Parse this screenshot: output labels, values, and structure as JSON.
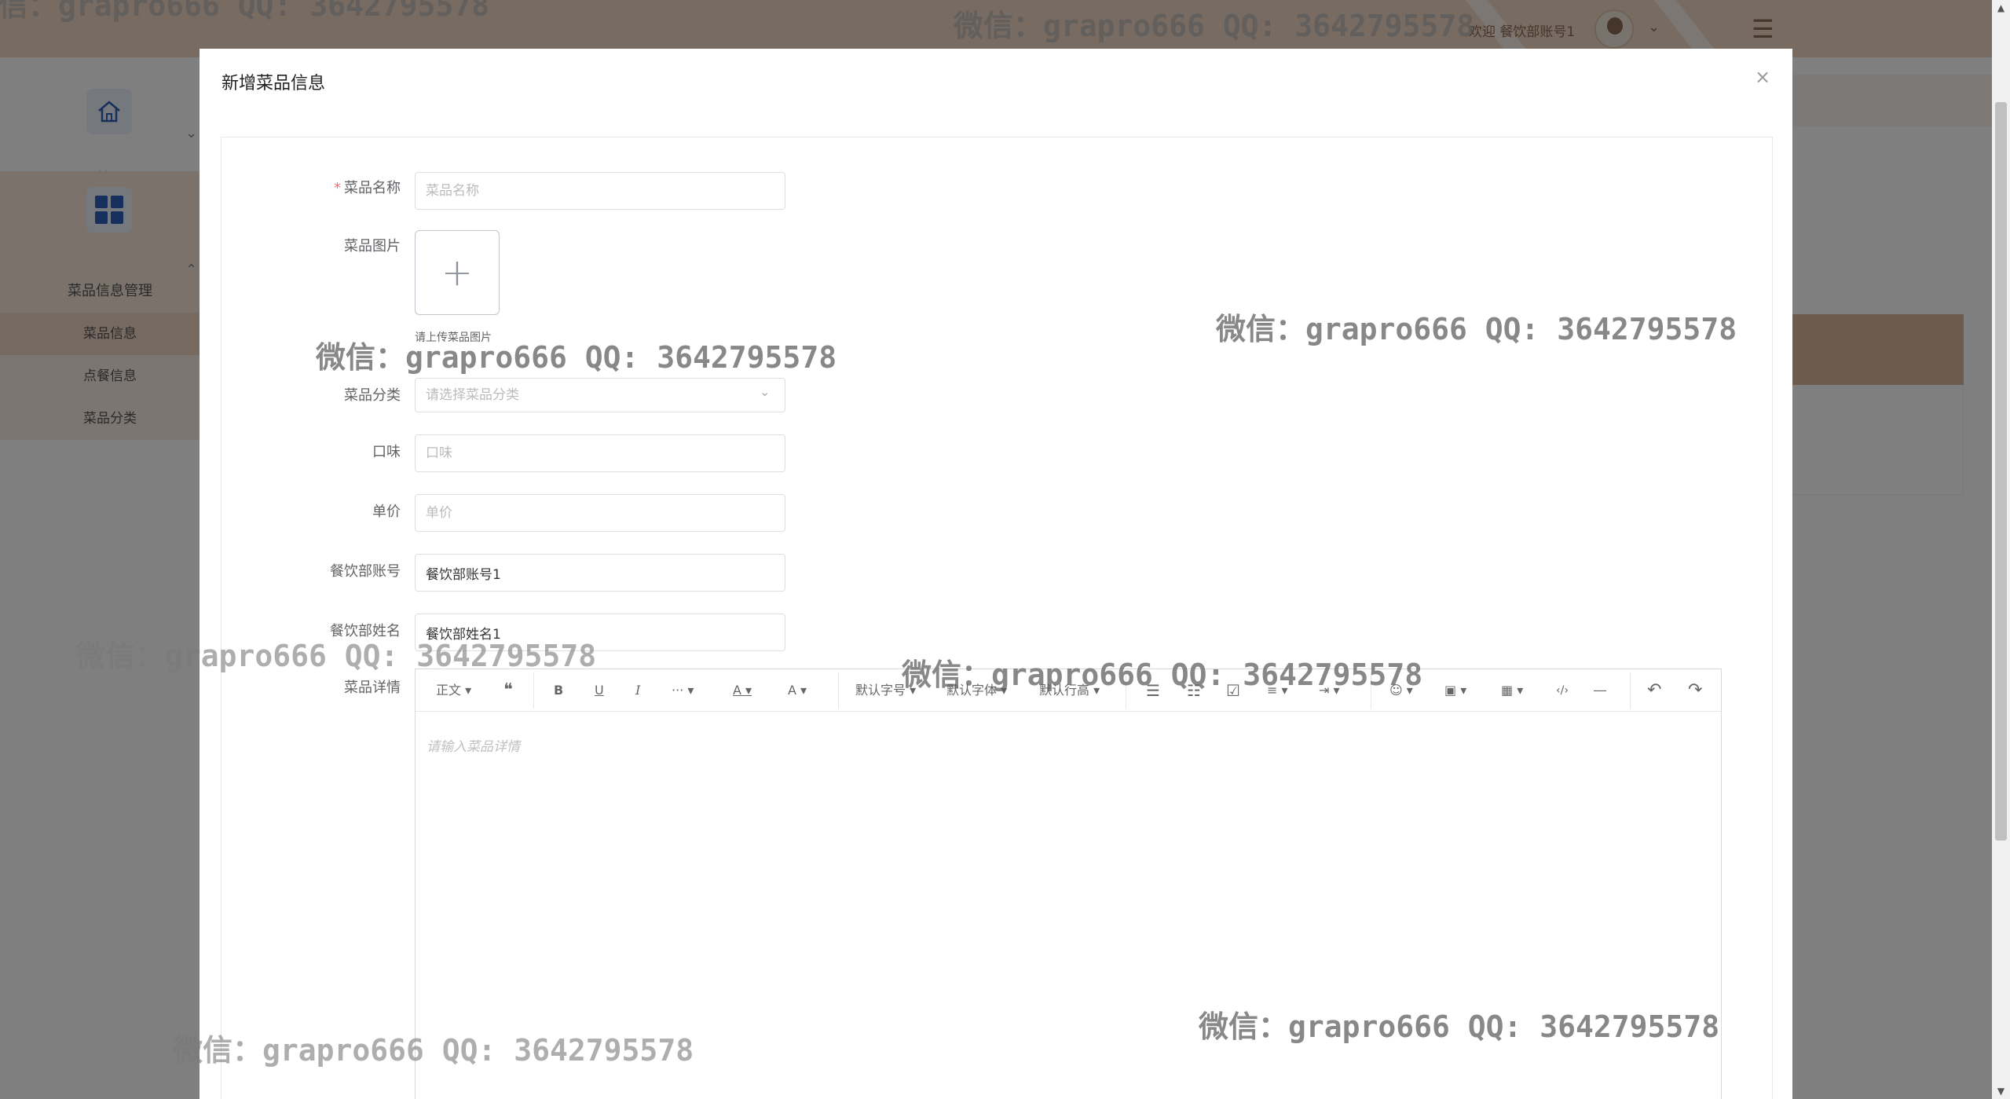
{
  "topbar": {
    "welcome": "欢迎 餐饮部账号1",
    "chevron": "⌄",
    "menu_icon": "☰"
  },
  "sidebar": {
    "home_label": "首页",
    "category_label": "菜品信息管理",
    "items": [
      {
        "label": "菜品信息"
      },
      {
        "label": "点餐信息"
      },
      {
        "label": "菜品分类"
      }
    ],
    "collapse_arrow": "⌄",
    "expand_arrow": "⌃"
  },
  "modal": {
    "title": "新增菜品信息",
    "close": "×",
    "fields": {
      "name": {
        "label": "菜品名称",
        "required_mark": "*",
        "placeholder": "菜品名称"
      },
      "image": {
        "label": "菜品图片",
        "upload_plus": "+",
        "tip": "请上传菜品图片"
      },
      "category": {
        "label": "菜品分类",
        "placeholder": "请选择菜品分类",
        "arrow": "⌄"
      },
      "taste": {
        "label": "口味",
        "placeholder": "口味"
      },
      "price": {
        "label": "单价",
        "placeholder": "单价"
      },
      "account": {
        "label": "餐饮部账号",
        "value": "餐饮部账号1"
      },
      "staff_name": {
        "label": "餐饮部姓名",
        "value": "餐饮部姓名1"
      },
      "detail": {
        "label": "菜品详情",
        "placeholder": "请输入菜品详情"
      }
    },
    "toolbar": {
      "paragraph": "正文 ▾",
      "quote": "❝",
      "bold": "B",
      "underline": "U",
      "italic": "I",
      "more": "··· ▾",
      "font_color": "A ▾",
      "bg_color": "A ▾",
      "font_size": "默认字号 ▾",
      "font_family": "默认字体 ▾",
      "line_height": "默认行高 ▾",
      "bullet_list": "☰",
      "numbered_list": "☷",
      "todo": "☑",
      "align": "≡ ▾",
      "indent": "⇥ ▾",
      "emoji": "☺ ▾",
      "image": "▣ ▾",
      "table": "▦ ▾",
      "code": "‹/›",
      "divider": "―",
      "undo": "↶",
      "redo": "↷"
    }
  },
  "watermark": "微信：grapro666 QQ: 3642795578"
}
